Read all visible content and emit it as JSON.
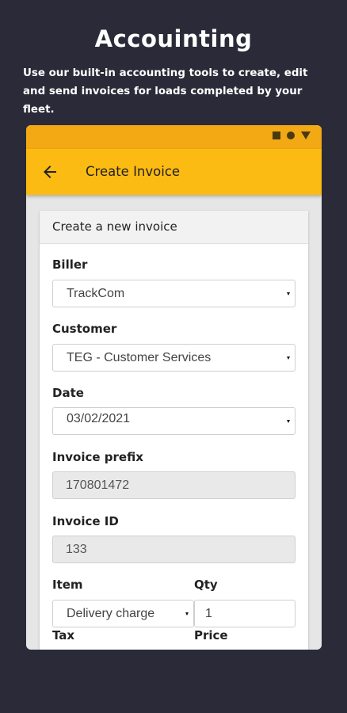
{
  "promo": {
    "title": "Accouinting",
    "subtitle": "Use our built-in accounting tools to create, edit and send invoices for loads completed by your fleet."
  },
  "status_bar": {
    "icons": [
      "square-icon",
      "circle-icon",
      "triangle-icon"
    ]
  },
  "app_bar": {
    "title": "Create Invoice",
    "back_icon": "arrow-left-icon"
  },
  "form": {
    "header": "Create a new invoice",
    "biller": {
      "label": "Biller",
      "value": "TrackCom"
    },
    "customer": {
      "label": "Customer",
      "value": "TEG - Customer Services"
    },
    "date": {
      "label": "Date",
      "value": "03/02/2021"
    },
    "invoice_prefix": {
      "label": "Invoice prefix",
      "value": "170801472"
    },
    "invoice_id": {
      "label": "Invoice ID",
      "value": "133"
    },
    "item": {
      "label": "Item",
      "value": "Delivery charge"
    },
    "qty": {
      "label": "Qty",
      "value": "1"
    },
    "tax": {
      "label": "Tax"
    },
    "price": {
      "label": "Price"
    }
  },
  "colors": {
    "background": "#2a2a38",
    "status_bar": "#f3a913",
    "app_bar": "#fcbb12"
  }
}
